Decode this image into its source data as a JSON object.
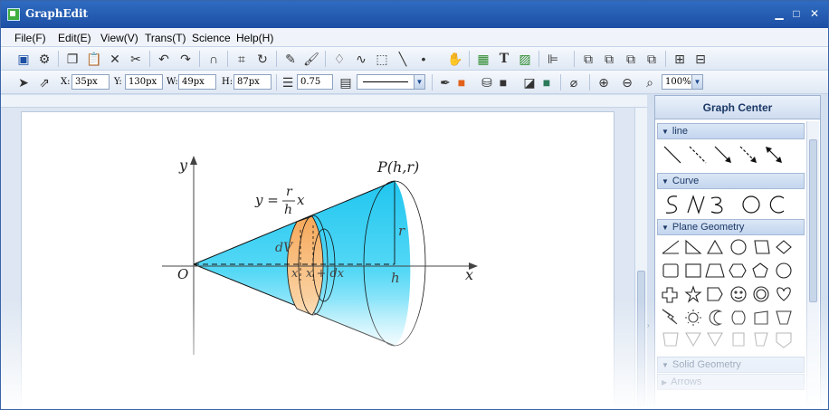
{
  "window": {
    "title": "GraphEdit"
  },
  "menu": [
    "File(F)",
    "Edit(E)",
    "View(V)",
    "Trans(T)",
    "Science",
    "Help(H)"
  ],
  "toolbar2": {
    "x_label": "X:",
    "x_value": "35px",
    "y_label": "Y:",
    "y_value": "130px",
    "w_label": "W:",
    "w_value": "49px",
    "h_label": "H:",
    "h_value": "87px",
    "line_width": "0.75",
    "zoom": "100%"
  },
  "panel": {
    "title": "Graph Center",
    "sections": [
      {
        "label": "line"
      },
      {
        "label": "Curve"
      },
      {
        "label": "Plane Geometry"
      },
      {
        "label": "Solid Geometry"
      },
      {
        "label": "Arrows"
      }
    ]
  },
  "figure": {
    "axis_y": "y",
    "axis_x": "x",
    "origin": "O",
    "point": "P(h,r)",
    "eq_prefix": "y =",
    "eq_num": "r",
    "eq_den": "h",
    "eq_var": "x",
    "dv": "dV",
    "r_label": "r",
    "h_label": "h",
    "x_label": "x",
    "xdx_label": "x + dx"
  },
  "colors": {
    "accent": "#1c4fa3",
    "cone": "#2fd0f2",
    "slice": "#f7b873"
  }
}
